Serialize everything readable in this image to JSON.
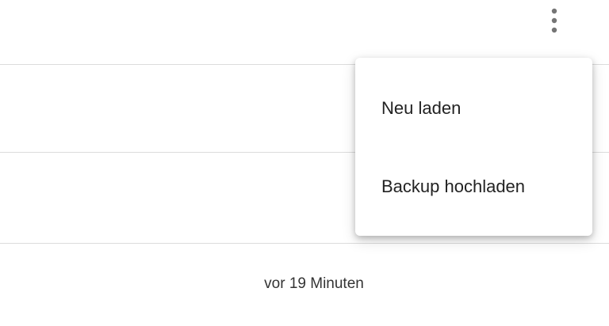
{
  "toolbar": {
    "more_icon": "more-vert-icon"
  },
  "list": {
    "timestamp": "vor 19 Minuten"
  },
  "menu": {
    "items": [
      {
        "label": "Neu laden"
      },
      {
        "label": "Backup hochladen"
      }
    ]
  },
  "colors": {
    "icon": "#757575",
    "divider": "#dcdcdc",
    "text": "#222222"
  }
}
